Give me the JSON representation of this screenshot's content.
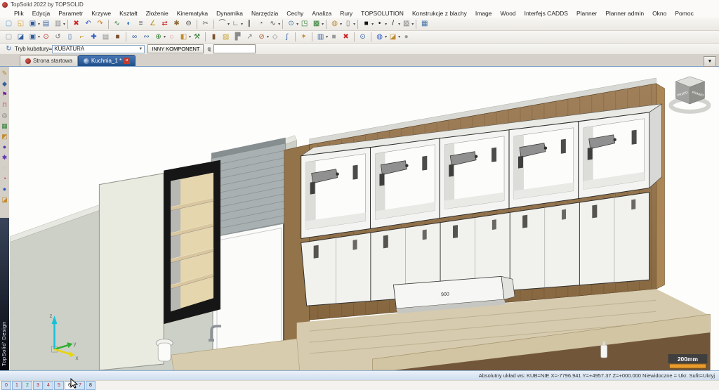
{
  "window": {
    "title": "TopSolid 2022 by TOPSOLID"
  },
  "menu": {
    "items": [
      "Plik",
      "Edycja",
      "Parametr",
      "Krzywe",
      "Kształt",
      "Złożenie",
      "Kinematyka",
      "Dynamika",
      "Narzędzia",
      "Cechy",
      "Analiza",
      "Rury",
      "TOPSOLUTION",
      "Konstrukcje z blachy",
      "Image",
      "Wood",
      "Interfejs CADDS",
      "Planner",
      "Planner admin",
      "Okno",
      "Pomoc"
    ]
  },
  "toolbar1": {
    "icons": [
      {
        "name": "new-document-icon",
        "glyph": "▢",
        "color": "#5b9bd5"
      },
      {
        "name": "open-icon",
        "glyph": "◱",
        "color": "#d9a441"
      },
      {
        "name": "save-icon",
        "glyph": "▣",
        "color": "#2f5e9e",
        "dd": true
      },
      {
        "name": "document-info-icon",
        "glyph": "▤",
        "color": "#2f5e9e"
      },
      {
        "name": "print-icon",
        "glyph": "▥",
        "color": "#8a8a8a",
        "dd": true
      },
      {
        "sep": true
      },
      {
        "name": "delete-icon",
        "glyph": "✖",
        "color": "#cc2a2a"
      },
      {
        "name": "undo-icon",
        "glyph": "↶",
        "color": "#2a56c6"
      },
      {
        "name": "redo-icon",
        "glyph": "↷",
        "color": "#d07a1f"
      },
      {
        "sep": true
      },
      {
        "name": "wireframe-icon",
        "glyph": "∿",
        "color": "#2e7d32"
      },
      {
        "name": "shading-icon",
        "glyph": "◐",
        "color": "#1565c0"
      },
      {
        "name": "section-icon",
        "glyph": "≡",
        "color": "#555555"
      },
      {
        "name": "measure-icon",
        "glyph": "∠",
        "color": "#b8860b"
      },
      {
        "name": "dimension-icon",
        "glyph": "⇄",
        "color": "#c62828"
      },
      {
        "name": "annotation-icon",
        "glyph": "✱",
        "color": "#8e6d3a"
      },
      {
        "name": "eclipse-icon",
        "glyph": "⊖",
        "color": "#444444"
      },
      {
        "sep": true
      },
      {
        "name": "scissors-icon",
        "glyph": "✂",
        "color": "#6a6a6a"
      },
      {
        "sep": true
      },
      {
        "name": "curve-tools-icon",
        "glyph": "⌒",
        "color": "#555555",
        "dd": true
      },
      {
        "name": "polyline-icon",
        "glyph": "∟",
        "color": "#555555",
        "dd": true
      },
      {
        "name": "parallel-icon",
        "glyph": "∥",
        "color": "#555555"
      },
      {
        "name": "contour-icon",
        "glyph": "◔",
        "color": "#555555"
      },
      {
        "name": "spline-icon",
        "glyph": "∿",
        "color": "#555555",
        "dd": true
      },
      {
        "sep": true
      },
      {
        "name": "zoom-icon",
        "glyph": "⊙",
        "color": "#3a6ea5",
        "dd": true
      },
      {
        "name": "fit-view-icon",
        "glyph": "◳",
        "color": "#2e7d32"
      },
      {
        "name": "render-icon",
        "glyph": "▩",
        "color": "#2e7d32",
        "dd": true
      },
      {
        "sep": true
      },
      {
        "name": "basket-icon",
        "glyph": "◍",
        "color": "#c08a2e",
        "dd": true
      },
      {
        "name": "battery-icon",
        "glyph": "▯",
        "color": "#777777",
        "dd": true
      },
      {
        "sep": true
      },
      {
        "name": "color-swatch",
        "glyph": "■",
        "color": "#111111",
        "dd": true
      },
      {
        "name": "point-style-icon",
        "glyph": "•",
        "color": "#111111",
        "dd": true
      },
      {
        "name": "line-style-icon",
        "glyph": "/",
        "color": "#111111",
        "dd": true
      },
      {
        "name": "hatch-style-icon",
        "glyph": "▨",
        "color": "#777777",
        "dd": true
      },
      {
        "sep": true
      },
      {
        "name": "attributes-icon",
        "glyph": "▦",
        "color": "#3a6ea5"
      }
    ]
  },
  "toolbar2": {
    "icons": [
      {
        "name": "new-part-icon",
        "glyph": "▢",
        "color": "#8a97a5"
      },
      {
        "name": "paste-icon",
        "glyph": "◪",
        "color": "#2f5e9e"
      },
      {
        "name": "save-as-icon",
        "glyph": "▣",
        "color": "#2f5e9e",
        "dd": true
      },
      {
        "name": "search-red-icon",
        "glyph": "⊙",
        "color": "#c03030"
      },
      {
        "name": "rotate-icon",
        "glyph": "↺",
        "color": "#777777"
      },
      {
        "name": "trash-icon",
        "glyph": "▯",
        "color": "#3a6ea5"
      },
      {
        "name": "key-icon",
        "glyph": "⌐",
        "color": "#b8860b"
      },
      {
        "name": "move-icon",
        "glyph": "✚",
        "color": "#2a56c6"
      },
      {
        "name": "copy-icon",
        "glyph": "▤",
        "color": "#8a8a8a"
      },
      {
        "name": "wood-block-icon",
        "glyph": "■",
        "color": "#7a5230"
      },
      {
        "sep": true
      },
      {
        "name": "link-icon",
        "glyph": "∞",
        "color": "#2f5e9e"
      },
      {
        "name": "chain-icon",
        "glyph": "∾",
        "color": "#2f5e9e"
      },
      {
        "name": "assembly-icon",
        "glyph": "⊕",
        "color": "#2e7d32",
        "dd": true
      },
      {
        "name": "select-box-icon",
        "glyph": "◌",
        "color": "#c04060"
      },
      {
        "name": "box-icon",
        "glyph": "◧",
        "color": "#c08a2e",
        "dd": true
      },
      {
        "name": "hammer-icon",
        "glyph": "⚒",
        "color": "#2e7d32"
      },
      {
        "sep": true
      },
      {
        "name": "panel-icon",
        "glyph": "▮",
        "color": "#7a5230"
      },
      {
        "name": "texture-icon",
        "glyph": "▨",
        "color": "#c9a227"
      },
      {
        "name": "sheet-bend-icon",
        "glyph": "▛",
        "color": "#8a8a8a"
      },
      {
        "name": "measure-arrow-icon",
        "glyph": "↗",
        "color": "#777777"
      },
      {
        "name": "drill-icon",
        "glyph": "⊘",
        "color": "#b05a2a",
        "dd": true
      },
      {
        "name": "cube-gray-icon",
        "glyph": "◇",
        "color": "#8a8a8a"
      },
      {
        "name": "pipe-icon",
        "glyph": "∫",
        "color": "#2f5e9e"
      },
      {
        "sep": true
      },
      {
        "name": "claw-icon",
        "glyph": "✶",
        "color": "#c08a2e"
      },
      {
        "sep": true
      },
      {
        "name": "window-layout-icon",
        "glyph": "▥",
        "color": "#2f5e9e",
        "dd": true
      },
      {
        "name": "block-icon",
        "glyph": "■",
        "color": "#999999"
      },
      {
        "name": "delete-component-icon",
        "glyph": "✖",
        "color": "#cc2a2a"
      },
      {
        "sep": true
      },
      {
        "name": "explore-icon",
        "glyph": "⊙",
        "color": "#2f5e9e"
      },
      {
        "sep": true
      },
      {
        "name": "world-icon",
        "glyph": "◍",
        "color": "#2a56c6",
        "dd": true
      },
      {
        "name": "open-project-icon",
        "glyph": "◪",
        "color": "#c08a2e",
        "dd": true
      },
      {
        "name": "elephant-icon",
        "glyph": "●",
        "color": "#9a9a9a"
      }
    ]
  },
  "toolbar3": {
    "mode_label": "Tryb kubatury=",
    "mode_value": "KUBATURA",
    "other_component_label": "INNY KOMPONENT",
    "q_label": "q",
    "text_field_value": ""
  },
  "left_toolbar": {
    "icons": [
      {
        "name": "sketch-icon",
        "glyph": "✎",
        "color": "#b8860b"
      },
      {
        "name": "part-icon",
        "glyph": "◆",
        "color": "#2f5e9e"
      },
      {
        "name": "flag-icon",
        "glyph": "⚑",
        "color": "#7b1fa2"
      },
      {
        "name": "clamp-icon",
        "glyph": "⊓",
        "color": "#c04060"
      },
      {
        "name": "target-icon",
        "glyph": "◎",
        "color": "#777777"
      },
      {
        "name": "toolbox-icon",
        "glyph": "▦",
        "color": "#2e7d32"
      },
      {
        "name": "palette-icon",
        "glyph": "◩",
        "color": "#c08a2e"
      },
      {
        "name": "disc-icon",
        "glyph": "●",
        "color": "#5e35b1"
      },
      {
        "name": "gear-icon",
        "glyph": "✱",
        "color": "#5e35b1"
      },
      {
        "name": "ghost-icon",
        "glyph": "◌",
        "color": "#8a97a5"
      },
      {
        "name": "chart-icon",
        "glyph": "◔",
        "color": "#c62828"
      },
      {
        "name": "sphere-icon",
        "glyph": "●",
        "color": "#2a56c6"
      },
      {
        "name": "folder-icon",
        "glyph": "◪",
        "color": "#c08a2e"
      }
    ]
  },
  "tabs": {
    "home_label": "Strona startowa",
    "doc_label": "Kuchnia_1 *",
    "close_glyph": "✖",
    "dropdown_glyph": "▼"
  },
  "scene": {
    "hood_label": "900",
    "scale_label": "200mm",
    "view_cube": {
      "left_face": "PRZÓD",
      "right_face": "PRAWO"
    },
    "axes": {
      "x": "x",
      "y": "y",
      "z": "z"
    }
  },
  "branding": {
    "vertical_label": "TopSolid' Design"
  },
  "status_bar": {
    "text": "Absolutny układ ws:  KUB=NIE  X=-7796.941  Y=+4957.37  Z=+000.000  Niewidoczne = Ukr.  Sufit=Ukryj"
  },
  "bottom_bar": {
    "view_buttons": [
      "0",
      "1",
      "2",
      "3",
      "4",
      "5",
      "6",
      "7",
      "8"
    ],
    "button_colors": [
      "#b22222",
      "#b22222",
      "#2a8a2a",
      "#b22222",
      "#b22222",
      "#b22222",
      "#222222",
      "#b22222",
      "#222222"
    ],
    "active_index": 6
  },
  "colors": {
    "accent_blue": "#2a5a9c",
    "wood": "#96764c",
    "wall": "#ccd0c6",
    "scale_bar": "#e89b2e"
  }
}
